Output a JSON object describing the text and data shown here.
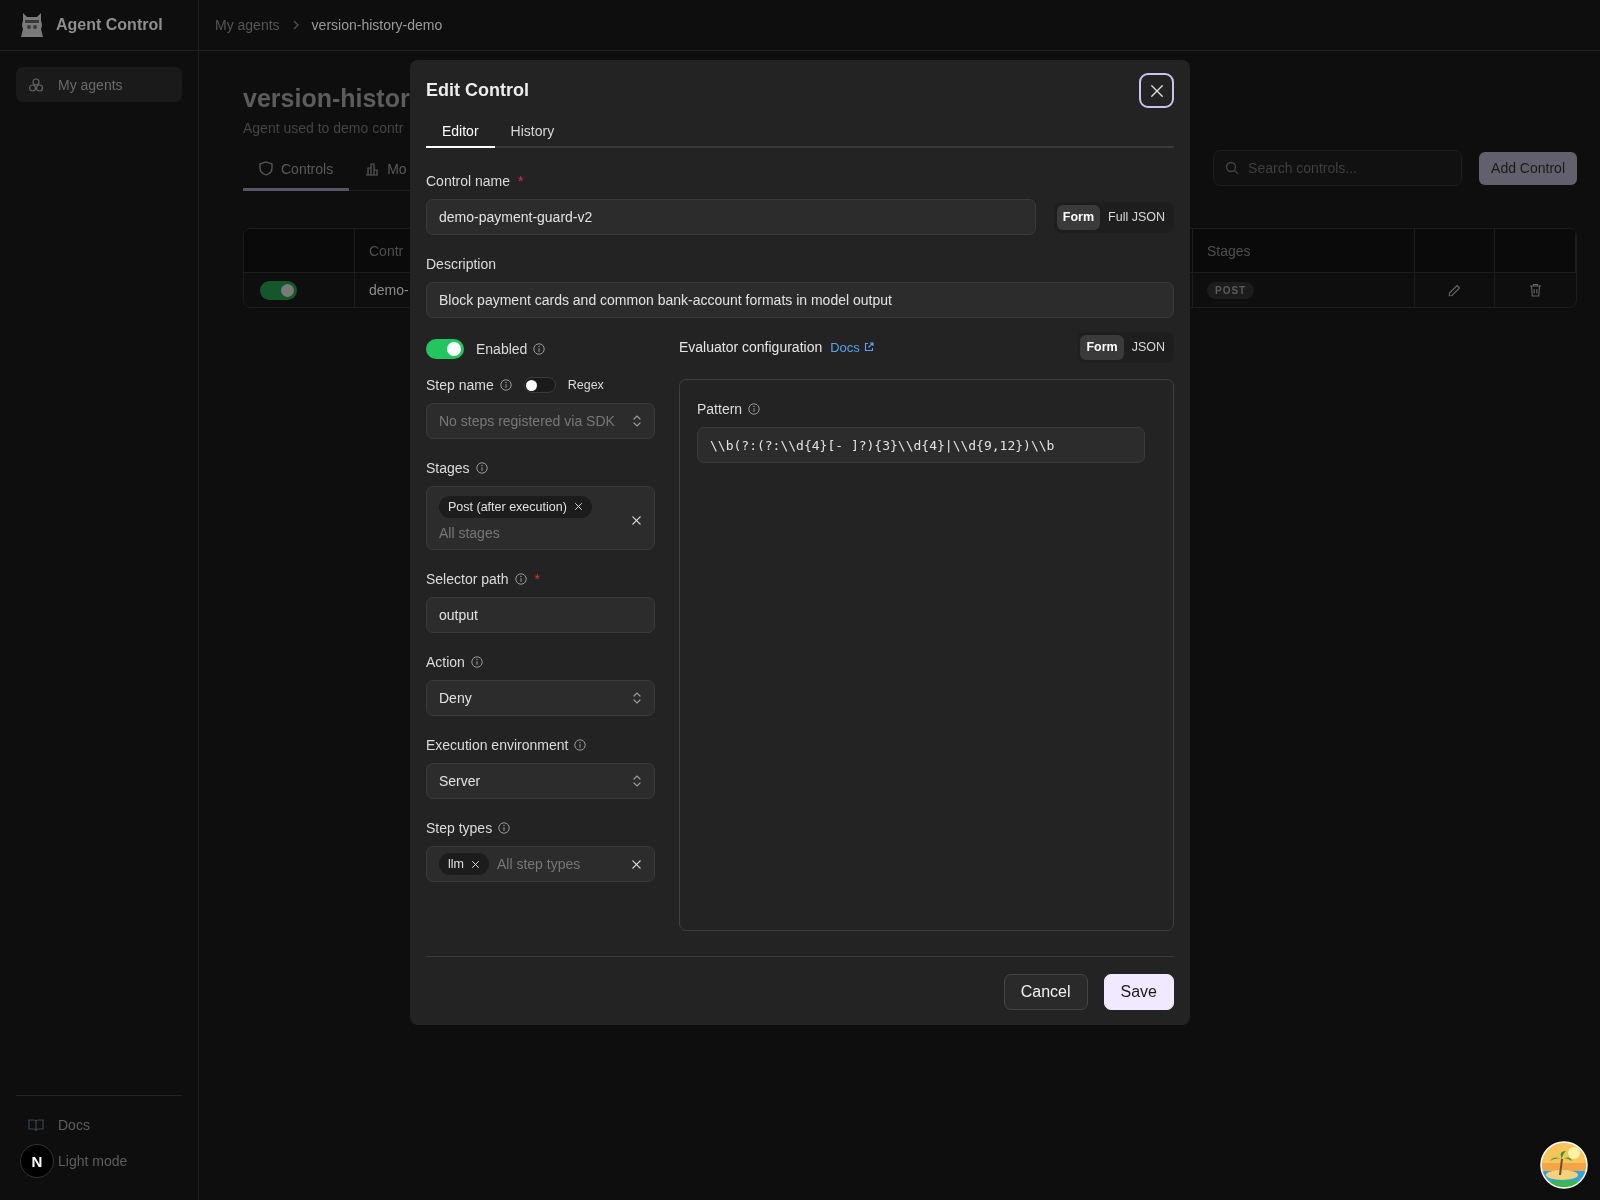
{
  "app": {
    "name": "Agent Control"
  },
  "breadcrumb": [
    {
      "label": "My agents",
      "current": false
    },
    {
      "label": "version-history-demo",
      "current": true
    }
  ],
  "sidebar": {
    "items": [
      {
        "label": "My agents",
        "selected": true
      }
    ],
    "footer": [
      {
        "kind": "docs",
        "label": "Docs"
      },
      {
        "kind": "theme",
        "label": "Light mode"
      }
    ]
  },
  "page": {
    "title": "version-histor",
    "subtitle": "Agent used to demo contr",
    "tabs": [
      {
        "kind": "controls",
        "label": "Controls",
        "selected": true
      },
      {
        "kind": "metrics",
        "label": "Mo",
        "selected": false
      }
    ],
    "search": {
      "placeholder": "Search controls..."
    },
    "add_button": "Add Control",
    "table": {
      "column_2": "Contr",
      "stages_column": "Stages",
      "rows": [
        {
          "enabled": true,
          "name": "demo-",
          "stages": [
            "POST"
          ]
        }
      ]
    }
  },
  "dialog": {
    "title": "Edit Control",
    "tabs": [
      {
        "label": "Editor",
        "selected": true
      },
      {
        "label": "History",
        "selected": false
      }
    ],
    "control_name": {
      "label": "Control name",
      "required_mark": "*",
      "value": "demo-payment-guard-v2"
    },
    "view_toggle": [
      {
        "label": "Form",
        "selected": true
      },
      {
        "label": "Full JSON",
        "selected": false
      }
    ],
    "description": {
      "label": "Description",
      "value": "Block payment cards and common bank-account formats in model output"
    },
    "enabled": {
      "label": "Enabled",
      "on": true,
      "info": true
    },
    "step_name": {
      "label": "Step name",
      "info": true,
      "regex_label": "Regex",
      "regex_on": false,
      "placeholder": "No steps registered via SDK"
    },
    "stages": {
      "label": "Stages",
      "info": true,
      "chips": [
        "Post (after execution)"
      ],
      "placeholder": "All stages"
    },
    "selector_path": {
      "label": "Selector path",
      "info": true,
      "required_mark": "*",
      "value": "output"
    },
    "action": {
      "label": "Action",
      "info": true,
      "value": "Deny"
    },
    "execution_environment": {
      "label": "Execution environment",
      "info": true,
      "value": "Server"
    },
    "step_types": {
      "label": "Step types",
      "info": true,
      "chips": [
        "llm"
      ],
      "placeholder": "All step types"
    },
    "evaluator": {
      "label": "Evaluator configuration",
      "docs_link": "Docs",
      "view_toggle": [
        {
          "label": "Form",
          "selected": true
        },
        {
          "label": "JSON",
          "selected": false
        }
      ],
      "pattern": {
        "label": "Pattern",
        "info": true,
        "value": "\\\\b(?:(?:\\\\d{4}[- ]?){3}\\\\d{4}|\\\\d{9,12})\\\\b"
      }
    },
    "buttons": [
      {
        "kind": "secondary",
        "label": "Cancel"
      },
      {
        "kind": "primary",
        "label": "Save"
      }
    ]
  },
  "dev_badge": "N"
}
